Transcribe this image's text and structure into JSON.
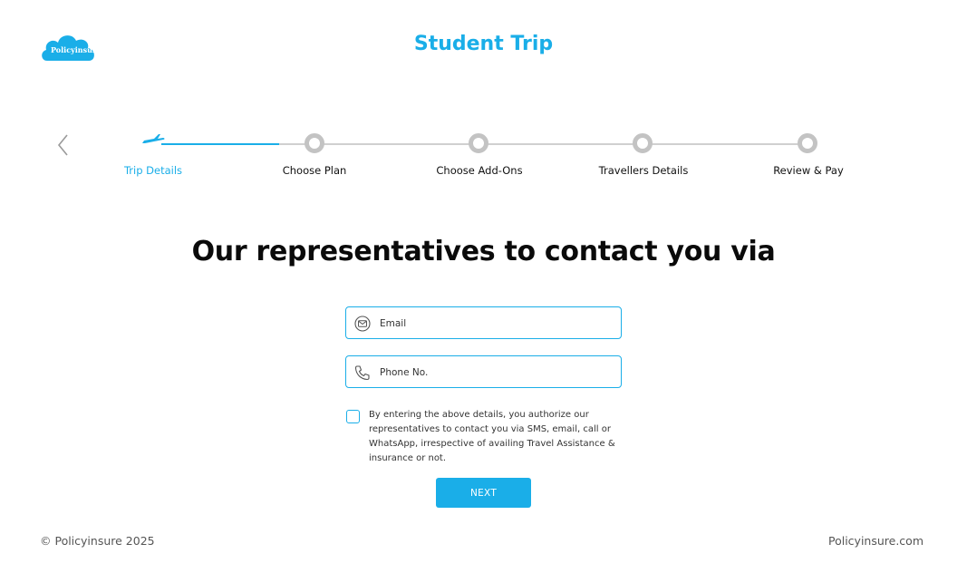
{
  "brand": {
    "logo_text": "Policyinsure",
    "accent": "#1aaee8"
  },
  "header": {
    "title": "Student Trip"
  },
  "nav": {
    "back_icon": "chevron-left-icon"
  },
  "stepper": {
    "steps": [
      {
        "label": "Trip Details",
        "state": "active",
        "icon": "airplane-icon"
      },
      {
        "label": "Choose Plan",
        "state": "pending"
      },
      {
        "label": "Choose Add-Ons",
        "state": "pending"
      },
      {
        "label": "Travellers Details",
        "state": "pending"
      },
      {
        "label": "Review & Pay",
        "state": "pending"
      }
    ]
  },
  "main": {
    "heading": "Our representatives to contact you via",
    "email": {
      "placeholder": "Email",
      "value": "",
      "icon": "envelope-icon"
    },
    "phone": {
      "placeholder": "Phone No.",
      "value": "",
      "icon": "phone-icon"
    },
    "consent_text": "By entering the above details, you authorize our representatives to contact you via SMS, email, call or WhatsApp, irrespective of availing Travel Assistance & insurance or not.",
    "consent_checked": false,
    "next_label": "NEXT"
  },
  "footer": {
    "copyright": "© Policyinsure 2025",
    "site": "Policyinsure.com"
  }
}
